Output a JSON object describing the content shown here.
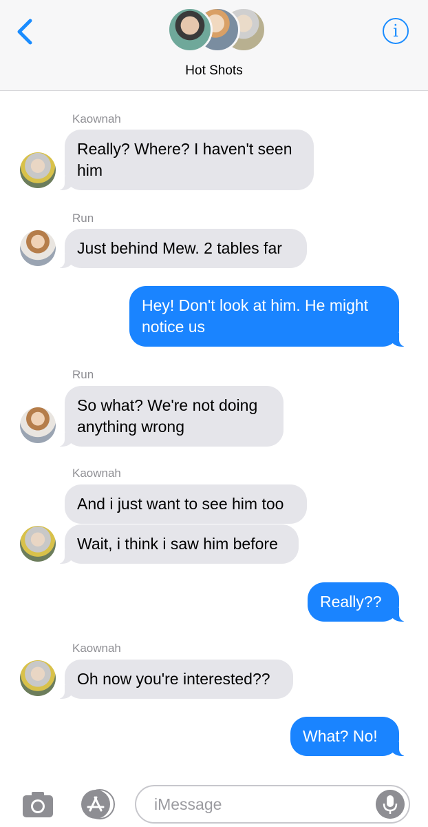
{
  "header": {
    "title": "Hot Shots",
    "back_icon": "chevron-left-icon",
    "info_icon": "info-icon",
    "info_glyph": "i",
    "accent_color": "#1a8cff"
  },
  "messages": [
    {
      "sender": "Kaownah",
      "direction": "incoming",
      "text": "Really? Where? I haven't seen him"
    },
    {
      "sender": "Run",
      "direction": "incoming",
      "text": "Just behind Mew. 2 tables far"
    },
    {
      "direction": "outgoing",
      "text": "Hey! Don't look at him. He might notice us"
    },
    {
      "sender": "Run",
      "direction": "incoming",
      "text": "So what? We're not doing anything wrong"
    },
    {
      "sender": "Kaownah",
      "direction": "incoming",
      "text": "And i just want to see him too"
    },
    {
      "direction": "incoming",
      "text": "Wait, i think i saw him before"
    },
    {
      "direction": "outgoing",
      "text": "Really??"
    },
    {
      "sender": "Kaownah",
      "direction": "incoming",
      "text": "Oh now you're interested??"
    },
    {
      "direction": "outgoing",
      "text": "What? No!"
    }
  ],
  "compose": {
    "placeholder": "iMessage",
    "camera_icon": "camera-icon",
    "apps_icon": "app-store-icon",
    "mic_icon": "microphone-icon"
  },
  "colors": {
    "incoming_bubble": "#e5e5ea",
    "outgoing_bubble": "#1a84ff",
    "sender_label": "#8e8e93"
  }
}
